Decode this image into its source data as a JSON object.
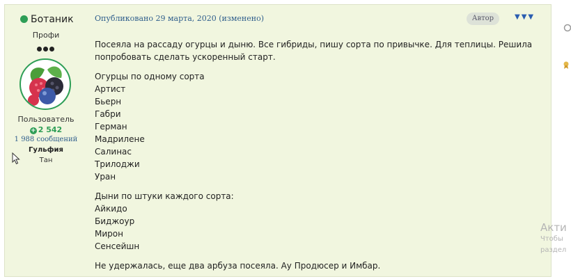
{
  "author": {
    "name": "Ботаник",
    "rank": "Профи",
    "group": "Пользователь",
    "reputation": "2 542",
    "posts": "1 988 сообщений",
    "real_name": "Гульфия",
    "city": "Тан",
    "online_color": "#2e9e56"
  },
  "post": {
    "meta": "Опубликовано 29 марта, 2020 (изменено)",
    "author_badge": "Автор",
    "menu_glyph": "▼▼▼",
    "body": [
      "Посеяла на рассаду огурцы и дыню. Все гибриды, пишу сорта по привычке. Для теплицы. Решила попробовать сделать ускоренный старт.",
      "Огурцы по одному сорта",
      "Артист",
      "Бьерн",
      "Габри",
      "Герман",
      "Мадрилене",
      "Салинас",
      "Трилоджи",
      "Уран",
      "Дыни по штуки каждого сорта:",
      "Айкидо",
      "Биджоур",
      "Мирон",
      "Сенсейшн",
      "Не удержалась, еще два арбуза посеяла. Ау Продюсер и Имбар."
    ]
  },
  "watermark": {
    "title": "Акти",
    "line1": "Чтобы",
    "line2": "раздел"
  },
  "icons": {
    "online": "online-dot-icon",
    "reputation": "plus-circle-icon",
    "menu": "chevron-down-icon"
  }
}
